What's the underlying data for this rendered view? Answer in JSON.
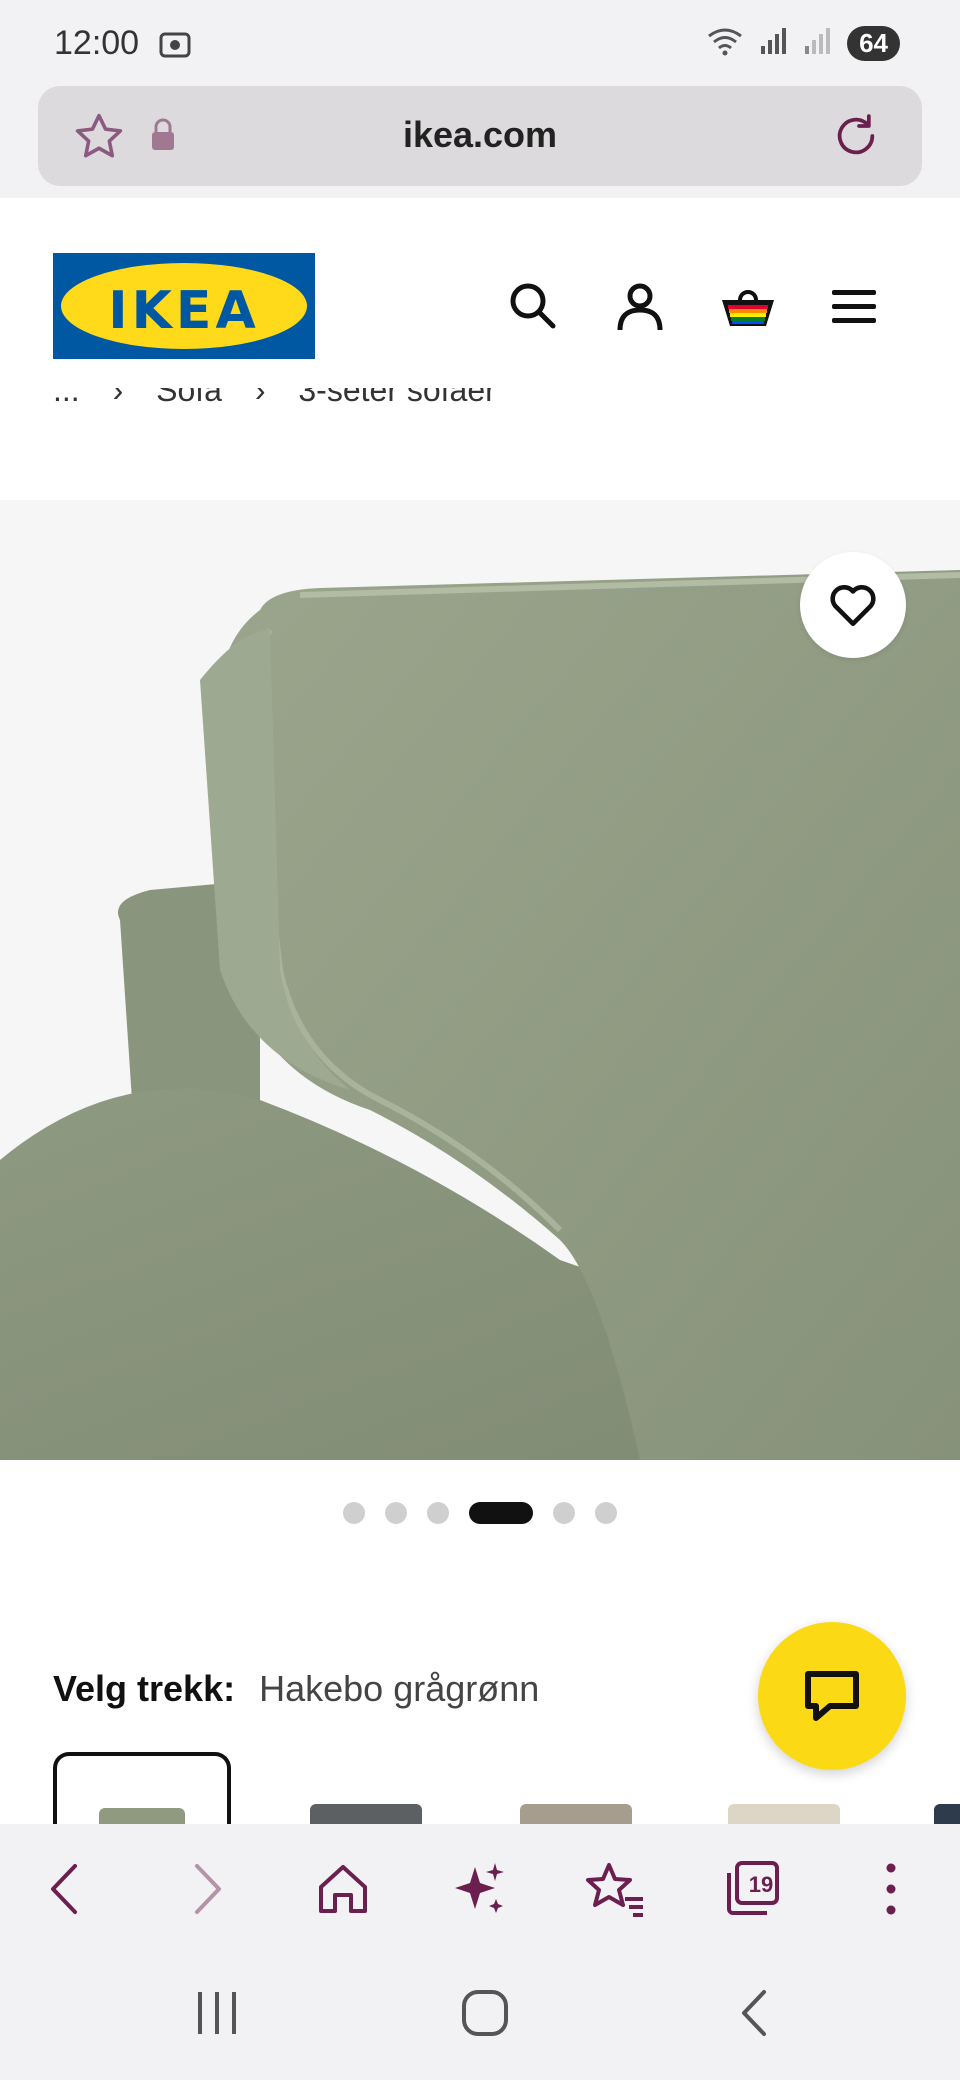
{
  "status_bar": {
    "time": "12:00",
    "battery": "64",
    "icons": [
      "screenshot-icon",
      "wifi-icon",
      "signal-icon",
      "signal-weak-icon"
    ]
  },
  "browser": {
    "url": "ikea.com",
    "tab_count": "19"
  },
  "site": {
    "logo_text": "IKEA",
    "header_icons": [
      "search-icon",
      "account-icon",
      "cart-icon",
      "menu-icon"
    ]
  },
  "breadcrumb": {
    "items": [
      "...",
      "Sofa",
      "3-seter sofaer"
    ]
  },
  "carousel": {
    "total": 6,
    "active_index": 3
  },
  "variant": {
    "label": "Velg trekk:",
    "value": "Hakebo grågrønn"
  },
  "colors": {
    "ikea_blue": "#0058a3",
    "ikea_yellow": "#ffda1a",
    "browser_accent": "#6b1f4f",
    "sofa_green": "#8f9a80"
  }
}
